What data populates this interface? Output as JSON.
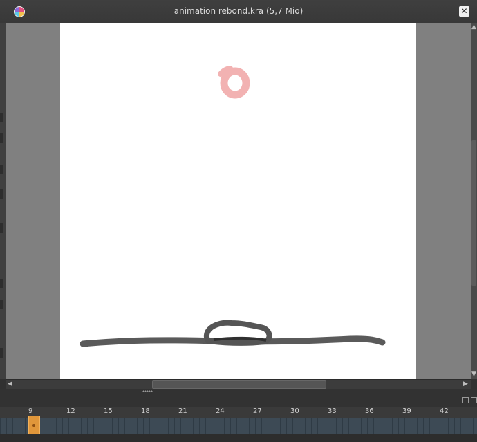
{
  "window": {
    "title": "animation rebond.kra (5,7 Mio)",
    "close_label": "✕",
    "app_icon": "krita-logo-icon"
  },
  "canvas": {
    "background": "#ffffff",
    "viewport_background": "#808080",
    "ball_color": "#f2b2b2",
    "ground_color": "#4a4a4a"
  },
  "scrollbars": {
    "left_arrow": "◀",
    "right_arrow": "▶",
    "up_arrow": "▲",
    "down_arrow": "▼"
  },
  "timeline": {
    "frame_labels": [
      "9",
      "12",
      "15",
      "18",
      "21",
      "24",
      "27",
      "30",
      "33",
      "36",
      "39",
      "42"
    ],
    "current_frame": 9,
    "playhead_color": "#e0963a",
    "track_color": "#3d4a55"
  }
}
